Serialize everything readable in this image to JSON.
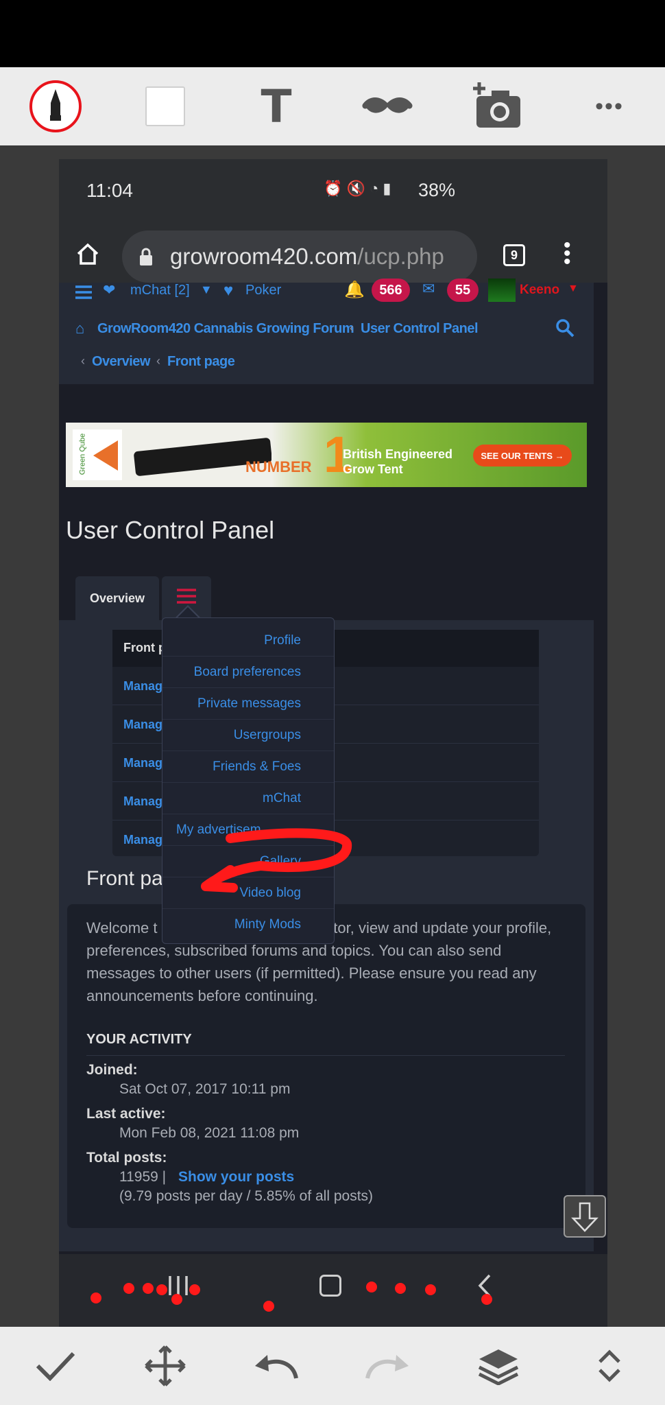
{
  "editor": {
    "top_tools": [
      "pen-tool-icon",
      "rectangle-tool-icon",
      "text-tool-icon",
      "mustache-sticker-icon",
      "add-photo-icon",
      "more-icon"
    ],
    "text_tool_glyph": "T",
    "more_glyph": "•••",
    "bottom_tools": [
      "confirm-check-icon",
      "move-icon",
      "undo-icon",
      "redo-icon",
      "layers-icon",
      "expand-collapse-icon"
    ]
  },
  "status": {
    "time": "11:04",
    "battery": "38%"
  },
  "browser": {
    "url_domain": "growroom420.com",
    "url_path": "/ucp.php",
    "tab_count": "9"
  },
  "forum": {
    "nav_mchat": "mChat [2]",
    "nav_poker": "Poker",
    "notifications_count": "566",
    "messages_count": "55",
    "username": "Keeno",
    "breadcrumb_home": "GrowRoom420 Cannabis Growing Forum",
    "breadcrumb_ucp": "User Control Panel",
    "breadcrumb_overview": "Overview",
    "breadcrumb_front": "Front page",
    "breadcrumb_sep": "‹"
  },
  "banner": {
    "brand": "Green Qube",
    "number_word": "NUMBER",
    "number_digit": "1",
    "tagline_1": "British Engineered",
    "tagline_2": "Grow Tent",
    "cta": "SEE OUR TENTS →"
  },
  "ucp": {
    "title": "User Control Panel",
    "tab_overview": "Overview",
    "list_header": "Front p",
    "list_rows": [
      "Manag",
      "Manag",
      "Manag",
      "Manag",
      "Manag"
    ],
    "front_heading": "Front pa",
    "welcome_text": "Welcome t                              . From here you can monitor, view and update your profile, preferences, subscribed forums and topics. You can also send messages to other users (if permitted). Please ensure you read any announcements before continuing.",
    "activity_heading": "YOUR ACTIVITY",
    "joined_label": "Joined:",
    "joined_value": "Sat Oct 07, 2017 10:11 pm",
    "last_active_label": "Last active:",
    "last_active_value": "Mon Feb 08, 2021 11:08 pm",
    "total_posts_label": "Total posts:",
    "total_posts_value": "11959 |",
    "show_posts_link": "Show your posts",
    "posts_stats": "(9.79 posts per day / 5.85% of all posts)"
  },
  "dropdown": {
    "items": [
      "Profile",
      "Board preferences",
      "Private messages",
      "Usergroups",
      "Friends & Foes",
      "mChat",
      "My advertisem",
      "Gallery",
      "Video blog",
      "Minty Mods"
    ]
  },
  "colors": {
    "link_blue": "#3a8ee6",
    "badge_red": "#c5164a",
    "annotation_red": "#ff1a1a",
    "username_red": "#e0161d"
  }
}
